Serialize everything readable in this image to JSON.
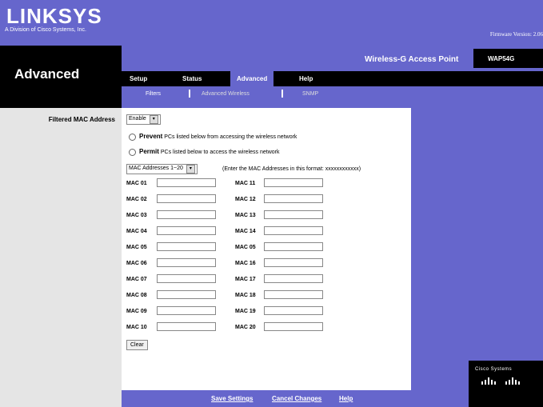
{
  "header": {
    "logo": "LINKSYS",
    "logo_sub": "A Division of Cisco Systems, Inc.",
    "firmware": "Firmware Version: 2.06"
  },
  "section": {
    "title": "Advanced"
  },
  "product": {
    "name": "Wireless-G Access Point",
    "model": "WAP54G"
  },
  "tabs": [
    {
      "label": "Setup"
    },
    {
      "label": "Status"
    },
    {
      "label": "Advanced"
    },
    {
      "label": "Help"
    }
  ],
  "subtabs": [
    {
      "label": "Filters"
    },
    {
      "label": "Advanced Wireless"
    },
    {
      "label": "SNMP"
    }
  ],
  "filter": {
    "label": "Filtered MAC Address",
    "select": "Enable",
    "prevent_bold": "Prevent",
    "prevent_rest": " PCs listed below from accessing the wireless network",
    "permit_bold": "Permit",
    "permit_rest": " PCs listed below to access the wireless network",
    "range_select": "MAC Addresses 1~20",
    "hint": "(Enter the MAC Addresses in this format: xxxxxxxxxxxx)"
  },
  "mac_labels_left": [
    "MAC 01",
    "MAC 02",
    "MAC 03",
    "MAC 04",
    "MAC 05",
    "MAC 06",
    "MAC 07",
    "MAC 08",
    "MAC 09",
    "MAC 10"
  ],
  "mac_labels_right": [
    "MAC 11",
    "MAC 12",
    "MAC 13",
    "MAC 14",
    "MAC 05",
    "MAC 16",
    "MAC 17",
    "MAC 18",
    "MAC 19",
    "MAC 20"
  ],
  "buttons": {
    "clear": "Clear",
    "save": "Save Settings",
    "cancel": "Cancel Changes",
    "help": "Help"
  },
  "footer": {
    "cisco": "Cisco Systems"
  },
  "colors": {
    "brand_purple": "#6666cc",
    "black": "#000000",
    "left_gray": "#e5e5e5"
  }
}
